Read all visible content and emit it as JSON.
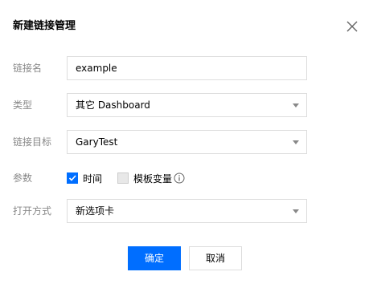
{
  "dialog": {
    "title": "新建链接管理",
    "close_icon": "close-icon"
  },
  "form": {
    "link_name": {
      "label": "链接名",
      "value": "example"
    },
    "type": {
      "label": "类型",
      "value": "其它 Dashboard"
    },
    "target": {
      "label": "链接目标",
      "value": "GaryTest"
    },
    "params": {
      "label": "参数",
      "options": [
        {
          "label": "时间",
          "checked": true
        },
        {
          "label": "模板变量",
          "checked": false
        }
      ],
      "info_icon": "info-icon"
    },
    "open_mode": {
      "label": "打开方式",
      "value": "新选项卡"
    }
  },
  "buttons": {
    "confirm": "确定",
    "cancel": "取消"
  },
  "colors": {
    "primary": "#006eff",
    "border": "#dddddd",
    "label": "#888888"
  }
}
